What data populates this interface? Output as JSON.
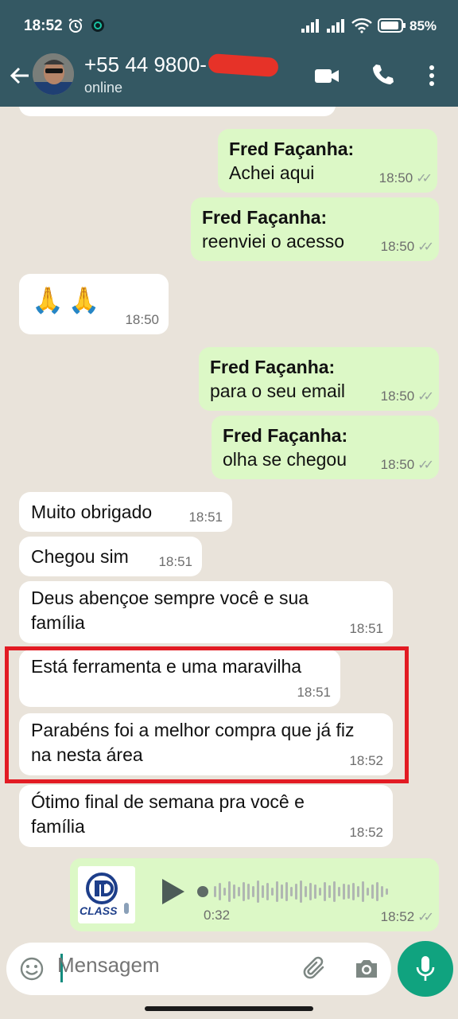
{
  "status_bar": {
    "time": "18:52",
    "battery": "85%"
  },
  "header": {
    "contact_name": "+55 44 9800-",
    "contact_status": "online"
  },
  "messages": [
    {
      "type": "out",
      "sender": "Fred Façanha:",
      "text": "Achei aqui",
      "time": "18:50"
    },
    {
      "type": "out",
      "sender": "Fred Façanha:",
      "text": "reenviei o acesso",
      "time": "18:50"
    },
    {
      "type": "in",
      "text": "🙏🙏",
      "time": "18:50"
    },
    {
      "type": "out",
      "sender": "Fred Façanha:",
      "text": "para o seu email",
      "time": "18:50"
    },
    {
      "type": "out",
      "sender": "Fred Façanha:",
      "text": "olha se chegou",
      "time": "18:50"
    },
    {
      "type": "in",
      "text": "Muito obrigado",
      "time": "18:51"
    },
    {
      "type": "in",
      "text": "Chegou sim",
      "time": "18:51"
    },
    {
      "type": "in",
      "text": "Deus abençoe sempre você e sua família",
      "time": "18:51"
    },
    {
      "type": "in",
      "text": "Está ferramenta e uma maravilha",
      "time": "18:51"
    },
    {
      "type": "in",
      "text": "Parabéns foi a melhor compra que já fiz na nesta área",
      "time": "18:52"
    },
    {
      "type": "in",
      "text": "Ótimo final de semana pra você e família",
      "time": "18:52"
    }
  ],
  "voice_message": {
    "thumb_label": "CLASS",
    "duration": "0:32",
    "time": "18:52"
  },
  "input": {
    "placeholder": "Mensagem"
  },
  "colors": {
    "header": "#345863",
    "outgoing_bubble": "#dcf8c6",
    "incoming_bubble": "#ffffff",
    "chat_background": "#e9e3da",
    "highlight_border": "#e21b23",
    "mic_button": "#10a37f"
  },
  "icons": [
    "back-arrow-icon",
    "video-call-icon",
    "phone-icon",
    "more-vert-icon",
    "emoji-icon",
    "attach-icon",
    "camera-icon",
    "mic-icon",
    "play-icon",
    "double-check-icon",
    "alarm-icon",
    "signal-icon",
    "wifi-icon",
    "battery-icon"
  ]
}
